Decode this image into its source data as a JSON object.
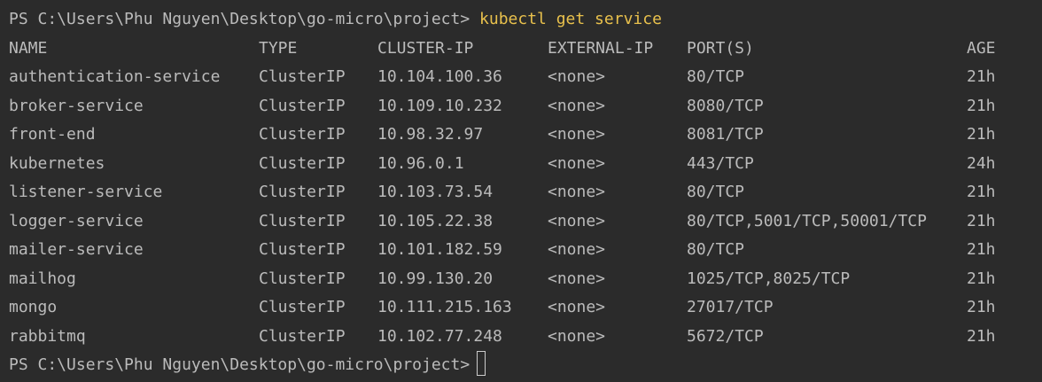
{
  "window": {
    "background": "#2b2b2b",
    "text_color": "#bbbbbb",
    "command_color": "#e8c04c"
  },
  "prompt": {
    "path": "PS C:\\Users\\Phu Nguyen\\Desktop\\go-micro\\project>",
    "command": "kubectl get service"
  },
  "table": {
    "headers": {
      "name": "NAME",
      "type": "TYPE",
      "cluster_ip": "CLUSTER-IP",
      "external_ip": "EXTERNAL-IP",
      "ports": "PORT(S)",
      "age": "AGE"
    },
    "rows": [
      {
        "name": "authentication-service",
        "type": "ClusterIP",
        "cluster_ip": "10.104.100.36",
        "external_ip": "<none>",
        "ports": "80/TCP",
        "age": "21h"
      },
      {
        "name": "broker-service",
        "type": "ClusterIP",
        "cluster_ip": "10.109.10.232",
        "external_ip": "<none>",
        "ports": "8080/TCP",
        "age": "21h"
      },
      {
        "name": "front-end",
        "type": "ClusterIP",
        "cluster_ip": "10.98.32.97",
        "external_ip": "<none>",
        "ports": "8081/TCP",
        "age": "21h"
      },
      {
        "name": "kubernetes",
        "type": "ClusterIP",
        "cluster_ip": "10.96.0.1",
        "external_ip": "<none>",
        "ports": "443/TCP",
        "age": "24h"
      },
      {
        "name": "listener-service",
        "type": "ClusterIP",
        "cluster_ip": "10.103.73.54",
        "external_ip": "<none>",
        "ports": "80/TCP",
        "age": "21h"
      },
      {
        "name": "logger-service",
        "type": "ClusterIP",
        "cluster_ip": "10.105.22.38",
        "external_ip": "<none>",
        "ports": "80/TCP,5001/TCP,50001/TCP",
        "age": "21h"
      },
      {
        "name": "mailer-service",
        "type": "ClusterIP",
        "cluster_ip": "10.101.182.59",
        "external_ip": "<none>",
        "ports": "80/TCP",
        "age": "21h"
      },
      {
        "name": "mailhog",
        "type": "ClusterIP",
        "cluster_ip": "10.99.130.20",
        "external_ip": "<none>",
        "ports": "1025/TCP,8025/TCP",
        "age": "21h"
      },
      {
        "name": "mongo",
        "type": "ClusterIP",
        "cluster_ip": "10.111.215.163",
        "external_ip": "<none>",
        "ports": "27017/TCP",
        "age": "21h"
      },
      {
        "name": "rabbitmq",
        "type": "ClusterIP",
        "cluster_ip": "10.102.77.248",
        "external_ip": "<none>",
        "ports": "5672/TCP",
        "age": "21h"
      }
    ]
  },
  "final_prompt": {
    "path": "PS C:\\Users\\Phu Nguyen\\Desktop\\go-micro\\project>"
  }
}
